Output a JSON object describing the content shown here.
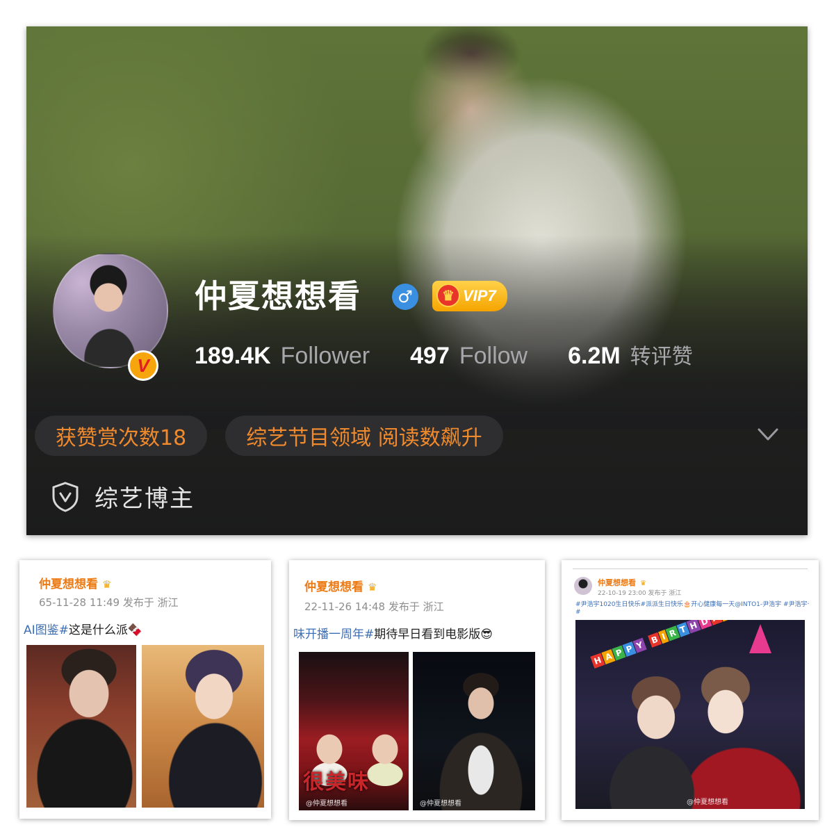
{
  "profile": {
    "username": "仲夏想想看",
    "vip_label": "VIP7",
    "stats": [
      {
        "value": "189.4K",
        "label": "Follower"
      },
      {
        "value": "497",
        "label": "Follow"
      },
      {
        "value": "6.2M",
        "label": "转评赞"
      }
    ],
    "tags": [
      "获赞赏次数18",
      "综艺节目领域 阅读数飙升"
    ],
    "role": "综艺博主",
    "colors": {
      "accent": "#f08a2c",
      "vip": "#f5a400",
      "gender": "#3b8fe0"
    }
  },
  "posts": [
    {
      "author": "仲夏想想看",
      "meta": "65-11-28 11:49  发布于 浙江",
      "hashtag": "AI图鉴#",
      "text": "这是什么派🍫"
    },
    {
      "author": "仲夏想想看",
      "meta": "22-11-26 14:48  发布于 浙江",
      "hashtag": "味开播一周年#",
      "text": "期待早日看到电影版😎",
      "poster_title": "很美味",
      "watermark": "@仲夏想想看"
    },
    {
      "author": "仲夏想想看",
      "meta": "22-10-19 23:00  发布于 浙江",
      "text_line1": "#尹浩宇1020生日快乐#派派生日快乐🎂开心健康每一天@INTO1-尹浩宇 #尹浩宇十九逐梦飞",
      "text_line2": "#",
      "birthday_banner": "HAPPY BIRTHDAY",
      "watermark": "@仲夏想想看"
    }
  ]
}
